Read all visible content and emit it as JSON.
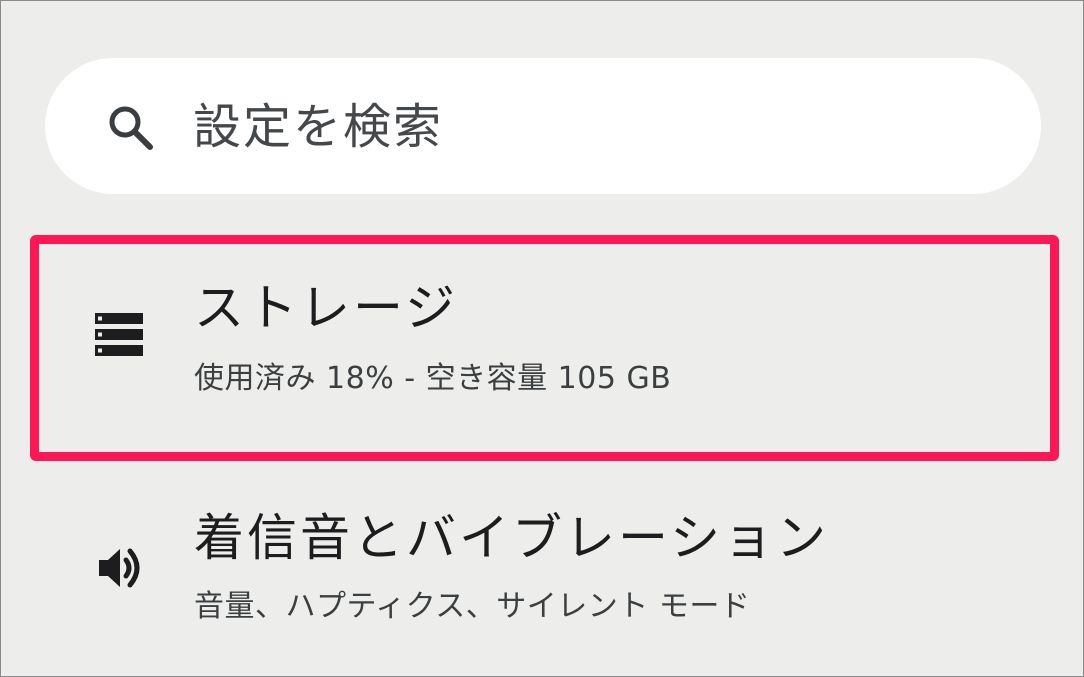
{
  "search": {
    "icon": "search-icon",
    "placeholder": "設定を検索"
  },
  "items": [
    {
      "icon": "storage-icon",
      "title": "ストレージ",
      "subtitle": "使用済み 18% - 空き容量 105 GB",
      "highlighted": true,
      "usage_percent": 18
    },
    {
      "icon": "speaker-icon",
      "title": "着信音とバイブレーション",
      "subtitle": "音量、ハプティクス、サイレント モード"
    }
  ],
  "colors": {
    "background": "#edeeeb",
    "highlight": "#ff1654",
    "text_primary": "#1d1d1f",
    "text_secondary": "#3c3f41"
  }
}
